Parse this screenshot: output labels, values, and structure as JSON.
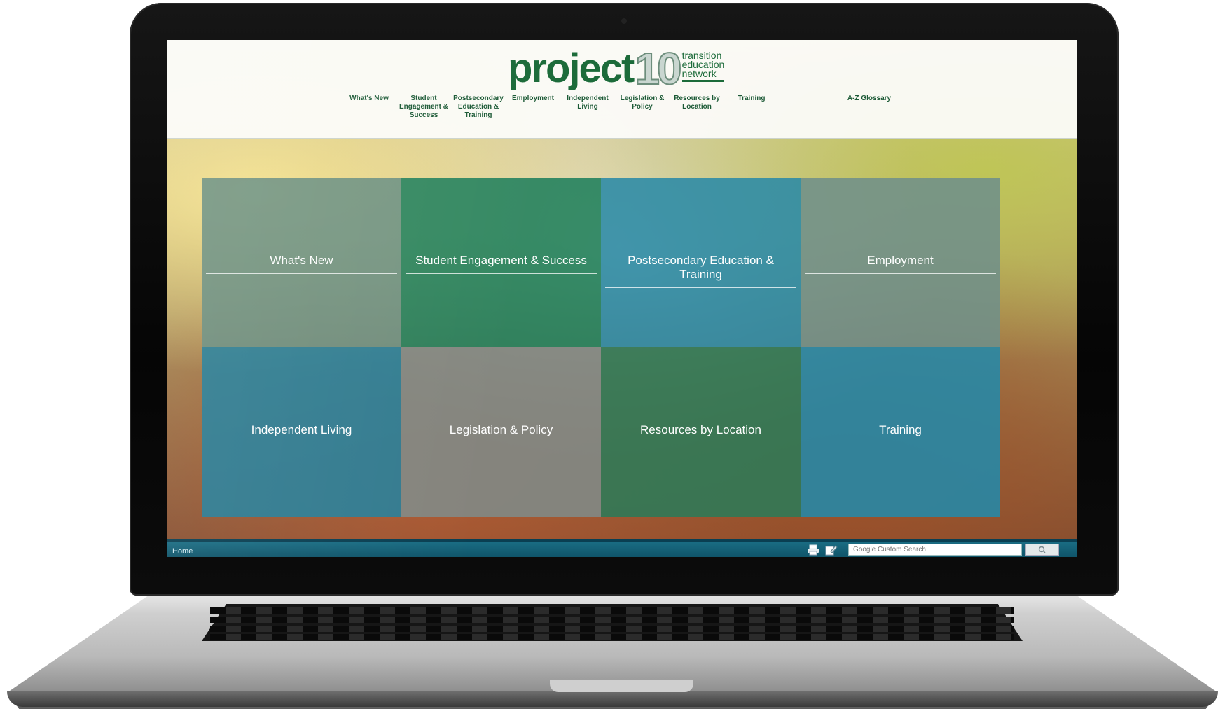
{
  "logo": {
    "word": "project",
    "number": "10",
    "tagline": [
      "transition",
      "education",
      "network"
    ]
  },
  "nav": {
    "items": [
      {
        "label": "What's New"
      },
      {
        "label": "Student Engagement & Success"
      },
      {
        "label": "Postsecondary Education & Training"
      },
      {
        "label": "Employment"
      },
      {
        "label": "Independent Living"
      },
      {
        "label": "Legislation & Policy"
      },
      {
        "label": "Resources by Location"
      },
      {
        "label": "Training"
      },
      {
        "label": "A-Z Glossary"
      }
    ]
  },
  "tiles": [
    {
      "label": "What's New",
      "color": "#6a8f83"
    },
    {
      "label": "Student Engagement & Success",
      "color": "#1f7f5c"
    },
    {
      "label": "Postsecondary Education & Training",
      "color": "#2a8aa6"
    },
    {
      "label": "Employment",
      "color": "#6f8f8a"
    },
    {
      "label": "Independent Living",
      "color": "#23809c"
    },
    {
      "label": "Legislation & Policy",
      "color": "#7f8a88"
    },
    {
      "label": "Resources by Location",
      "color": "#2c7a58"
    },
    {
      "label": "Training",
      "color": "#2489a8"
    }
  ],
  "footer": {
    "home_label": "Home",
    "search_placeholder": "Google Custom Search"
  },
  "colors": {
    "brand_green": "#1c6b3a",
    "footer_bar": "#146076"
  },
  "icons": [
    "print-icon",
    "edit-icon",
    "search-icon"
  ]
}
